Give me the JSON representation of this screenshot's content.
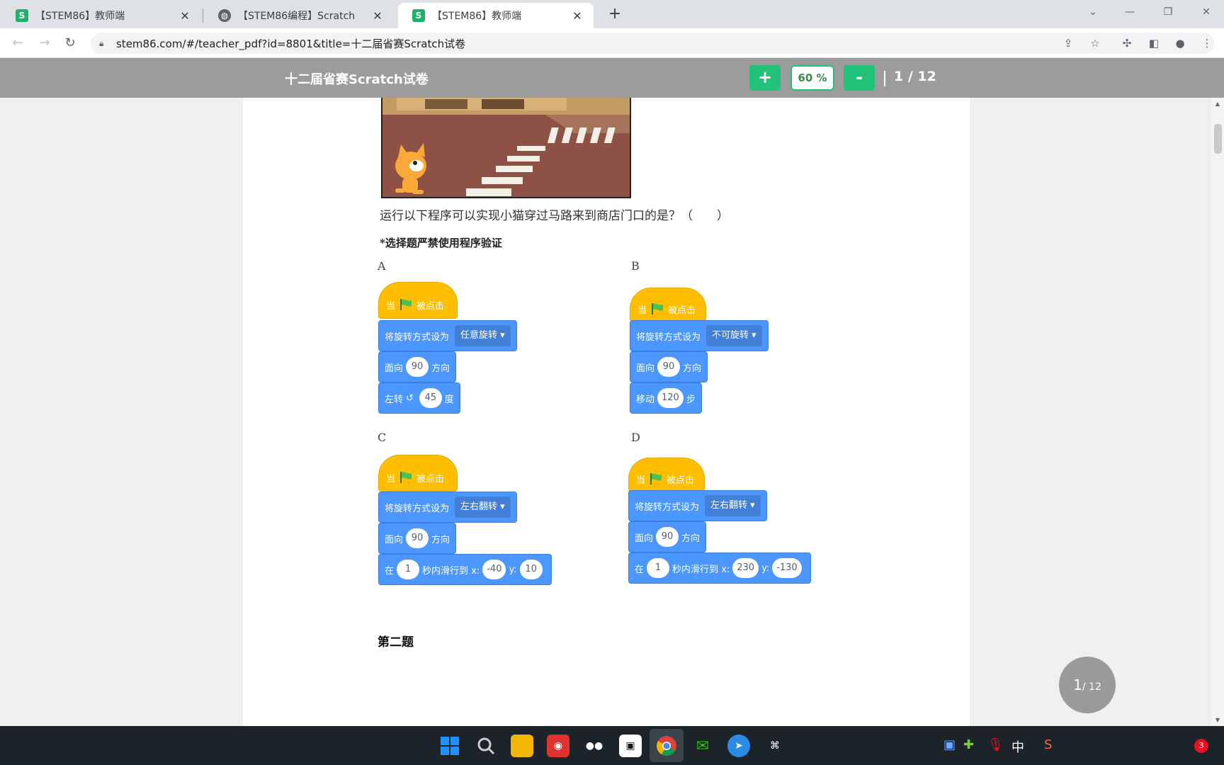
{
  "browser": {
    "tabs": [
      {
        "title": "【STEM86】教师端",
        "favicon": "stem86-icon",
        "active": false
      },
      {
        "title": "【STEM86编程】Scratch",
        "favicon": "globe-icon",
        "active": false
      },
      {
        "title": "【STEM86】教师端",
        "favicon": "stem86-icon",
        "active": true
      }
    ],
    "new_tab_label": "+",
    "url": "stem86.com/#/teacher_pdf?id=8801&title=十二届省赛Scratch试卷"
  },
  "viewer": {
    "doc_title": "十二届省赛Scratch试卷",
    "zoom_in_label": "+",
    "zoom_level": "60 %",
    "zoom_out_label": "-",
    "page_indicator": "1 / 12",
    "badge_current": "1",
    "badge_total": "/ 12"
  },
  "content": {
    "question": "运行以下程序可以实现小猫穿过马路来到商店门口的是？（　　）",
    "note": "*选择题严禁使用程序验证",
    "section_title": "第二题",
    "options": {
      "A": {
        "letter": "A",
        "hat": {
          "pre": "当",
          "post": "被点击"
        },
        "rotation_label": "将旋转方式设为",
        "rotation_value": "任意旋转",
        "face_pre": "面向",
        "face_val": "90",
        "face_post": "方向",
        "last_pre": "左转",
        "last_val": "45",
        "last_post": "度"
      },
      "B": {
        "letter": "B",
        "hat": {
          "pre": "当",
          "post": "被点击"
        },
        "rotation_label": "将旋转方式设为",
        "rotation_value": "不可旋转",
        "face_pre": "面向",
        "face_val": "90",
        "face_post": "方向",
        "last_pre": "移动",
        "last_val": "120",
        "last_post": "步"
      },
      "C": {
        "letter": "C",
        "hat": {
          "pre": "当",
          "post": "被点击"
        },
        "rotation_label": "将旋转方式设为",
        "rotation_value": "左右翻转",
        "face_pre": "面向",
        "face_val": "90",
        "face_post": "方向",
        "glide_pre": "在",
        "glide_secs": "1",
        "glide_mid": "秒内滑行到 x:",
        "glide_x": "-40",
        "glide_ylabel": "y:",
        "glide_y": "10"
      },
      "D": {
        "letter": "D",
        "hat": {
          "pre": "当",
          "post": "被点击"
        },
        "rotation_label": "将旋转方式设为",
        "rotation_value": "左右翻转",
        "face_pre": "面向",
        "face_val": "90",
        "face_post": "方向",
        "glide_pre": "在",
        "glide_secs": "1",
        "glide_mid": "秒内滑行到 x:",
        "glide_x": "230",
        "glide_ylabel": "y:",
        "glide_y": "-130"
      }
    }
  },
  "taskbar": {
    "ime_label": "中",
    "notification_count": "3"
  },
  "colors": {
    "accent_green": "#22c27a",
    "scratch_event": "#ffbf00",
    "scratch_motion": "#4c97ff",
    "header_gray": "#9c9c9c"
  }
}
